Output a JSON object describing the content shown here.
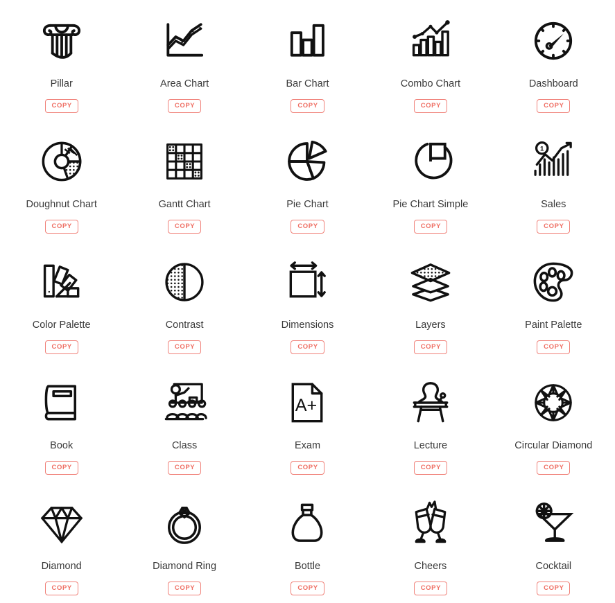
{
  "page": {
    "background_color": "#ffffff",
    "label_color": "#3a3a3a",
    "icon_stroke_color": "#111111",
    "accent_color": "#ef6f64",
    "copy_label": "COPY",
    "columns": 5,
    "rows": 5
  },
  "icons": [
    {
      "name": "Pillar",
      "glyph": "pillar",
      "copy": "COPY"
    },
    {
      "name": "Area Chart",
      "glyph": "area-chart",
      "copy": "COPY"
    },
    {
      "name": "Bar Chart",
      "glyph": "bar-chart",
      "copy": "COPY"
    },
    {
      "name": "Combo Chart",
      "glyph": "combo-chart",
      "copy": "COPY"
    },
    {
      "name": "Dashboard",
      "glyph": "dashboard",
      "copy": "COPY"
    },
    {
      "name": "Doughnut Chart",
      "glyph": "doughnut-chart",
      "copy": "COPY"
    },
    {
      "name": "Gantt Chart",
      "glyph": "gantt-chart",
      "copy": "COPY"
    },
    {
      "name": "Pie Chart",
      "glyph": "pie-chart",
      "copy": "COPY"
    },
    {
      "name": "Pie Chart Simple",
      "glyph": "pie-chart-simple",
      "copy": "COPY"
    },
    {
      "name": "Sales",
      "glyph": "sales",
      "copy": "COPY"
    },
    {
      "name": "Color Palette",
      "glyph": "color-palette",
      "copy": "COPY"
    },
    {
      "name": "Contrast",
      "glyph": "contrast",
      "copy": "COPY"
    },
    {
      "name": "Dimensions",
      "glyph": "dimensions",
      "copy": "COPY"
    },
    {
      "name": "Layers",
      "glyph": "layers",
      "copy": "COPY"
    },
    {
      "name": "Paint Palette",
      "glyph": "paint-palette",
      "copy": "COPY"
    },
    {
      "name": "Book",
      "glyph": "book",
      "copy": "COPY"
    },
    {
      "name": "Class",
      "glyph": "class",
      "copy": "COPY"
    },
    {
      "name": "Exam",
      "glyph": "exam",
      "copy": "COPY"
    },
    {
      "name": "Lecture",
      "glyph": "lecture",
      "copy": "COPY"
    },
    {
      "name": "Circular Diamond",
      "glyph": "circular-diamond",
      "copy": "COPY"
    },
    {
      "name": "Diamond",
      "glyph": "diamond",
      "copy": "COPY"
    },
    {
      "name": "Diamond Ring",
      "glyph": "diamond-ring",
      "copy": "COPY"
    },
    {
      "name": "Bottle",
      "glyph": "bottle",
      "copy": "COPY"
    },
    {
      "name": "Cheers",
      "glyph": "cheers",
      "copy": "COPY"
    },
    {
      "name": "Cocktail",
      "glyph": "cocktail",
      "copy": "COPY"
    }
  ]
}
